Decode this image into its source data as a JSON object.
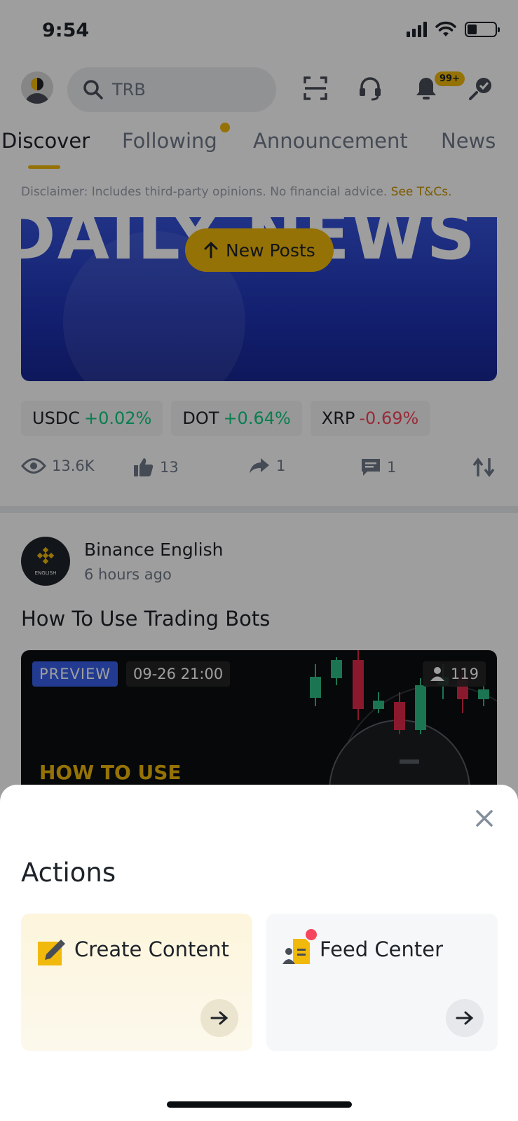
{
  "status_bar": {
    "time": "9:54",
    "battery_level": 0.35
  },
  "top_bar": {
    "search_value": "TRB",
    "notification_badge": "99+"
  },
  "tabs": [
    {
      "label": "Discover",
      "active": true
    },
    {
      "label": "Following",
      "active": false,
      "has_dot": true
    },
    {
      "label": "Announcement",
      "active": false
    },
    {
      "label": "News",
      "active": false
    }
  ],
  "disclaimer": {
    "text": "Disclaimer: Includes third-party opinions. No financial advice.",
    "link": "See T&Cs."
  },
  "banner": {
    "title": "DAILY NEWS",
    "new_posts_label": "New Posts"
  },
  "coins": [
    {
      "symbol": "USDC",
      "change": "+0.02%",
      "direction": "up"
    },
    {
      "symbol": "DOT",
      "change": "+0.64%",
      "direction": "up"
    },
    {
      "symbol": "XRP",
      "change": "-0.69%",
      "direction": "down"
    }
  ],
  "stats": {
    "views": "13.6K",
    "likes": "13",
    "shares": "1",
    "comments": "1"
  },
  "post": {
    "author": "Binance English",
    "avatar_caption": "ENGLISH",
    "time": "6 hours ago",
    "title": "How To Use Trading Bots",
    "preview_tag": "PREVIEW",
    "date_tag": "09-26 21:00",
    "viewers": "119",
    "video_caption": "HOW TO USE"
  },
  "sheet": {
    "title": "Actions",
    "create_label": "Create Content",
    "feed_label": "Feed Center"
  },
  "colors": {
    "brand_yellow": "#f0b90b",
    "up_green": "#0ecb81",
    "down_red": "#f6465d",
    "text_primary": "#1e2329",
    "text_secondary": "#707a8a"
  }
}
